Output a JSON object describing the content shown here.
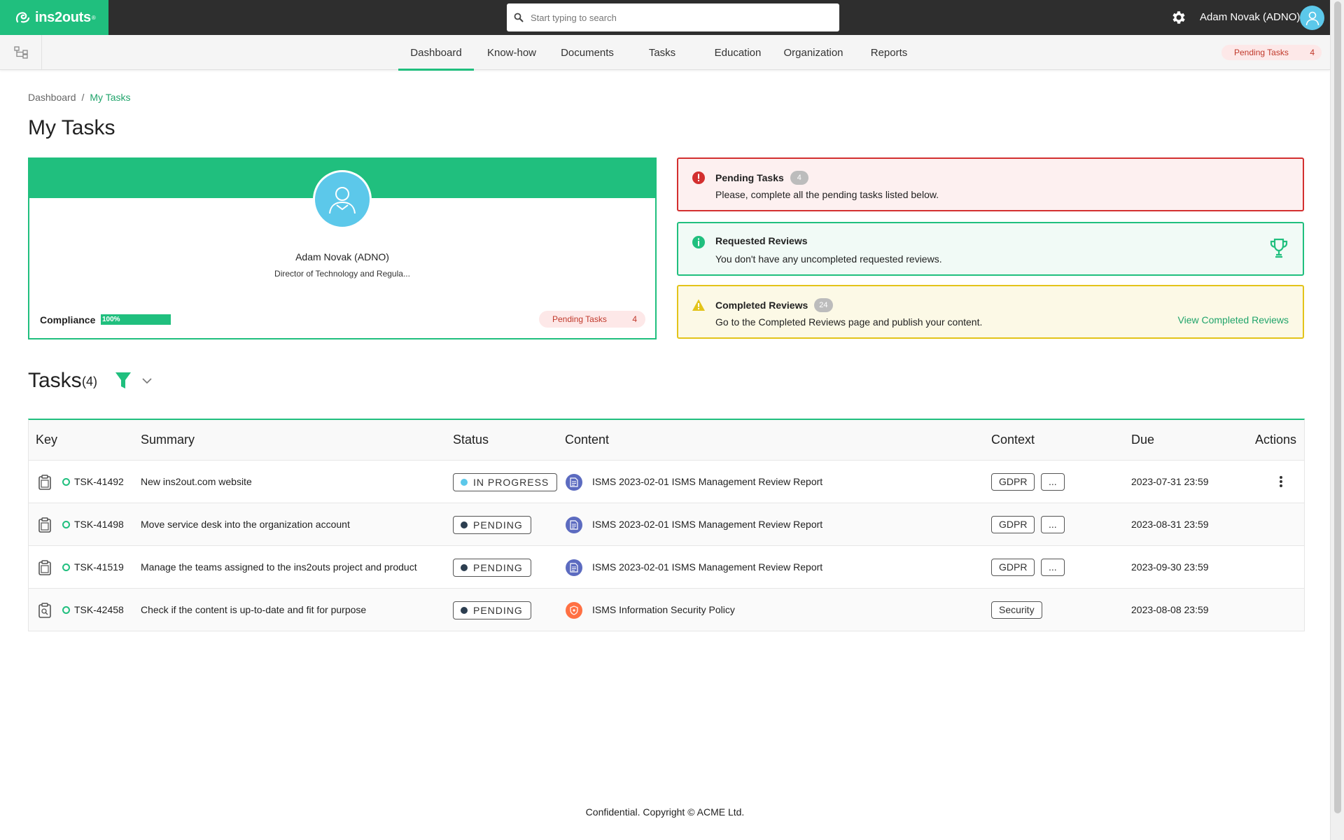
{
  "app": {
    "logo_text": "ins2outs",
    "logo_reg": "®",
    "search_placeholder": "Start typing to search",
    "user_name": "Adam Novak (ADNO)"
  },
  "nav": {
    "tabs": [
      {
        "label": "Dashboard",
        "active": true
      },
      {
        "label": "Know-how",
        "active": false
      },
      {
        "label": "Documents",
        "active": false
      },
      {
        "label": "Tasks",
        "active": false
      },
      {
        "label": "Education",
        "active": false
      },
      {
        "label": "Organization",
        "active": false
      },
      {
        "label": "Reports",
        "active": false
      }
    ],
    "pending_label": "Pending Tasks",
    "pending_count": "4"
  },
  "breadcrumb": {
    "root": "Dashboard",
    "separator": "/",
    "current": "My Tasks"
  },
  "page_title": "My Tasks",
  "profile": {
    "name": "Adam Novak (ADNO)",
    "role": "Director of Technology and Regula...",
    "compliance_label": "Compliance",
    "compliance_value": "100%",
    "compliance_fraction": 1.0,
    "pending_label": "Pending Tasks",
    "pending_count": "4"
  },
  "alerts": {
    "pending": {
      "title": "Pending Tasks",
      "count": "4",
      "text": "Please, complete all the pending tasks listed below."
    },
    "requested": {
      "title": "Requested Reviews",
      "text": "You don't have any uncompleted requested reviews."
    },
    "completed": {
      "title": "Completed Reviews",
      "count": "24",
      "text": "Go to the Completed Reviews page and publish your content.",
      "link": "View Completed Reviews"
    }
  },
  "tasks": {
    "title": "Tasks",
    "count": "(4)",
    "columns": {
      "key": "Key",
      "summary": "Summary",
      "status": "Status",
      "content": "Content",
      "context": "Context",
      "due": "Due",
      "actions": "Actions"
    },
    "rows": [
      {
        "key": "TSK-41492",
        "summary": "New ins2out.com website",
        "status": "IN PROGRESS",
        "content": "ISMS 2023-02-01 ISMS Management Review Report",
        "context": "GDPR",
        "context_more": "...",
        "due": "2023-07-31 23:59"
      },
      {
        "key": "TSK-41498",
        "summary": "Move service desk into the organization account",
        "status": "PENDING",
        "content": "ISMS 2023-02-01 ISMS Management Review Report",
        "context": "GDPR",
        "context_more": "...",
        "due": "2023-08-31 23:59"
      },
      {
        "key": "TSK-41519",
        "summary": "Manage the teams assigned to the ins2outs project and product",
        "status": "PENDING",
        "content": "ISMS 2023-02-01 ISMS Management Review Report",
        "context": "GDPR",
        "context_more": "...",
        "due": "2023-09-30 23:59"
      },
      {
        "key": "TSK-42458",
        "summary": "Check if the content is up-to-date and fit for purpose",
        "status": "PENDING",
        "content": "ISMS Information Security Policy",
        "context": "Security",
        "due": "2023-08-08 23:59"
      }
    ]
  },
  "footer": "Confidential. Copyright © ACME Ltd.",
  "colors": {
    "brand_green": "#20bf7e",
    "topbar": "#2e2e2e",
    "danger": "#d32f2f",
    "warning": "#e3c41a",
    "avatar_blue": "#5cc8ea",
    "status_in_progress": "#5cc8ea",
    "status_pending": "#2c3e50",
    "report_icon": "#5c6bc0",
    "policy_icon": "#ff7043"
  },
  "icons": {
    "logo": "ins2outs-logo-icon",
    "search": "search-icon",
    "settings": "gear-icon",
    "user": "user-icon",
    "tree": "tree-view-icon",
    "task": "clipboard-icon",
    "report": "document-icon",
    "policy": "shield-badge-icon",
    "trophy": "trophy-icon",
    "filter": "filter-icon",
    "menu": "kebab-menu-icon"
  }
}
